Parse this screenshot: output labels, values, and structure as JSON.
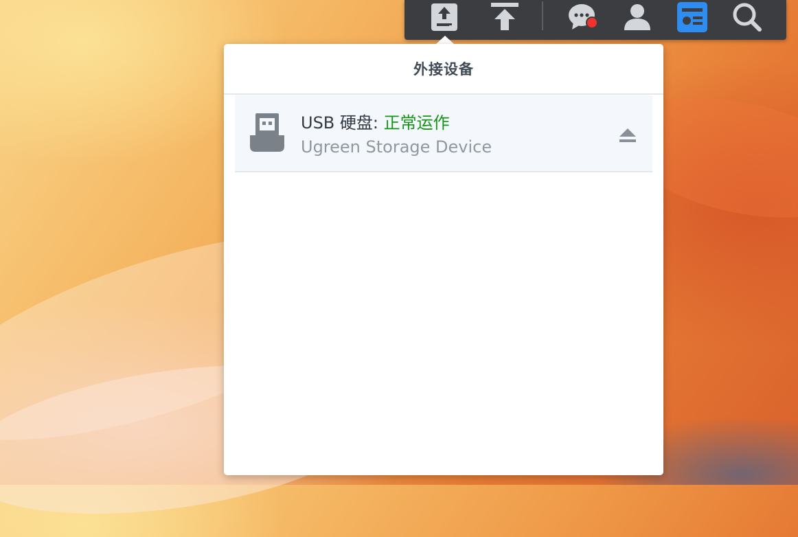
{
  "taskbar": {
    "buttons": [
      {
        "icon": "external-device-icon",
        "active": true
      },
      {
        "icon": "upload-icon"
      },
      {
        "icon": "notifications-icon",
        "has_badge": true
      },
      {
        "icon": "user-icon"
      },
      {
        "icon": "widgets-icon"
      },
      {
        "icon": "search-icon"
      }
    ],
    "colors": {
      "bar": "#3b3d40",
      "icon": "#d3d6da",
      "accent": "#2f8cf0",
      "badge": "#f0322f"
    }
  },
  "popup": {
    "title": "外接设备",
    "devices": [
      {
        "type_label": "USB 硬盘:",
        "status": "正常运作",
        "name": "Ugreen Storage Device",
        "icon": "usb-drive-icon",
        "action_icon": "eject-icon"
      }
    ],
    "colors": {
      "status_ok": "#179317",
      "row_bg": "#f4f7fb"
    }
  }
}
